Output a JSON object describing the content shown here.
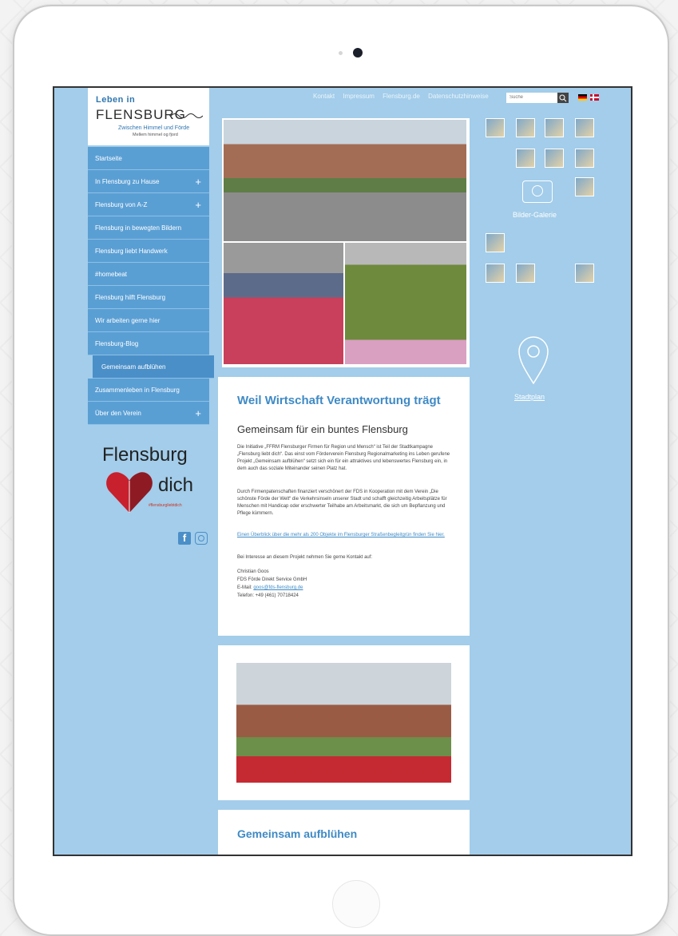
{
  "header": {
    "logo_line1": "Leben in",
    "logo_line2": "FLENSBURG",
    "logo_tagline": "Zwischen Himmel und Förde",
    "logo_tagline_dk": "Mellem himmel og fjord",
    "top_links": [
      "Kontakt",
      "Impressum",
      "Flensburg.de",
      "Datenschutzhinweise"
    ],
    "search_placeholder": "Suche"
  },
  "nav": {
    "items": [
      {
        "label": "Startseite",
        "expand": ""
      },
      {
        "label": "In Flensburg zu Hause",
        "expand": "+"
      },
      {
        "label": "Flensburg von A-Z",
        "expand": "+"
      },
      {
        "label": "Flensburg in bewegten Bildern",
        "expand": ""
      },
      {
        "label": "Flensburg liebt Handwerk",
        "expand": ""
      },
      {
        "label": "#homebeat",
        "expand": ""
      },
      {
        "label": "Flensburg hilft Flensburg",
        "expand": ""
      },
      {
        "label": "Wir arbeiten gerne hier",
        "expand": ""
      },
      {
        "label": "Flensburg-Blog",
        "expand": ""
      },
      {
        "label": "Gemeinsam aufblühen",
        "expand": ""
      },
      {
        "label": "Zusammenleben in Flensburg",
        "expand": ""
      },
      {
        "label": "Über den Verein",
        "expand": "+"
      }
    ]
  },
  "campaign": {
    "word1": "Flensburg",
    "word2": "dich",
    "hashtag": "#flensburgliebtdich"
  },
  "gallery": {
    "label": "Bilder-Galerie"
  },
  "map": {
    "label": "Stadtplan"
  },
  "article": {
    "title": "Weil Wirtschaft Verantwortung trägt",
    "subtitle": "Gemeinsam für ein buntes Flensburg",
    "p1": "Die Initiative „FFRM Flensburger Firmen für Region und Mensch“ ist Teil der Stadtkampagne „Flensburg liebt dich“. Das einst vom Förderverein Flensburg Regionalmarketing ins Leben gerufene Projekt „Gemeinsam aufblühen“ setzt sich ein für ein attraktives und lebenswertes Flensburg ein, in dem auch das soziale Miteinander seinen Platz hat.",
    "p2": "Durch Firmenpatenschaften finanziert verschönert der FDS in Kooperation mit dem Verein „Die schönste Förde der Welt“ die Verkehrsinseln unserer Stadt und schafft gleichzeitig Arbeitsplätze für Menschen mit Handicap oder erschwerter Teilhabe am Arbeitsmarkt, die sich um Bepflanzung und Pflege kümmern.",
    "link": "Einen Überblick über die mehr als 200 Objekte im Flensburger Straßenbegleitgrün finden Sie hier.",
    "p3": "Bei Interesse an diesem Projekt nehmen Sie gerne Kontakt auf:",
    "contact_name": "Christian Goos",
    "contact_company": "FDS Förde Direkt Service GmbH",
    "contact_email_label": "E-Mail:",
    "contact_email": "goos@fds-flensburg.de",
    "contact_phone": "Telefon: +49 (461) 70718424"
  },
  "card3": {
    "title": "Gemeinsam aufblühen"
  }
}
